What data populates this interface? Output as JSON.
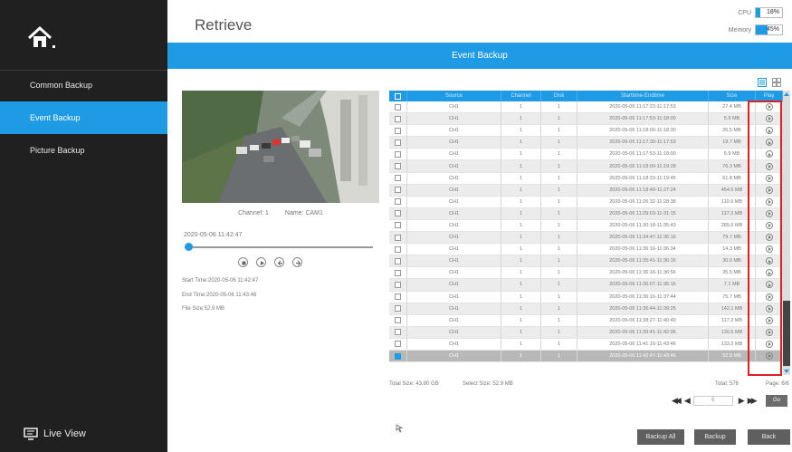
{
  "sidebar": {
    "items": [
      {
        "label": "Common Backup",
        "active": false
      },
      {
        "label": "Event Backup",
        "active": true
      },
      {
        "label": "Picture Backup",
        "active": false
      }
    ],
    "live_view": "Live View"
  },
  "header": {
    "title": "Retrieve",
    "cpu": {
      "label": "CPU",
      "value": "18%",
      "level": 0.18
    },
    "memory": {
      "label": "Memory",
      "value": "45%",
      "level": 0.45
    }
  },
  "banner": {
    "title": "Event Backup"
  },
  "preview": {
    "channel": "Channel: 1",
    "name": "Name: CAM1",
    "timestamp": "2020-05-06 11:42:47",
    "start_time": "Start Time:2020-05-06 11:42:47",
    "end_time": "End Time:2020-05-06 11:43:46",
    "file_size": "File Size:52.9 MB"
  },
  "table": {
    "columns": [
      "Source",
      "Channel",
      "Disk",
      "Starttime-Endtime",
      "Size",
      "Play"
    ],
    "rows": [
      {
        "source": "CH1",
        "channel": "1",
        "disk": "1",
        "time": "2020-05-06 11:17:23-11:17:53",
        "size": "27.4 MB",
        "checked": false
      },
      {
        "source": "CH1",
        "channel": "1",
        "disk": "1",
        "time": "2020-05-06 11:17:53-11:18:00",
        "size": "5.9 MB",
        "checked": false
      },
      {
        "source": "CH1",
        "channel": "1",
        "disk": "1",
        "time": "2020-05-06 11:18:00-11:18:30",
        "size": "26.5 MB",
        "checked": false
      },
      {
        "source": "CH1",
        "channel": "1",
        "disk": "1",
        "time": "2020-05-06 11:17:30-11:17:53",
        "size": "19.7 MB",
        "checked": false
      },
      {
        "source": "CH1",
        "channel": "1",
        "disk": "1",
        "time": "2020-05-06 11:17:53-11:18:00",
        "size": "5.9 MB",
        "checked": false
      },
      {
        "source": "CH1",
        "channel": "1",
        "disk": "1",
        "time": "2020-05-06 11:18:00-11:19:28",
        "size": "76.3 MB",
        "checked": false
      },
      {
        "source": "CH1",
        "channel": "1",
        "disk": "1",
        "time": "2020-05-06 11:18:33-11:19:45",
        "size": "61.8 MB",
        "checked": false
      },
      {
        "source": "CH1",
        "channel": "1",
        "disk": "1",
        "time": "2020-05-06 11:18:49-11:27:24",
        "size": "454.5 MB",
        "checked": false
      },
      {
        "source": "CH1",
        "channel": "1",
        "disk": "1",
        "time": "2020-05-06 11:26:32-11:28:38",
        "size": "110.9 MB",
        "checked": false
      },
      {
        "source": "CH1",
        "channel": "1",
        "disk": "1",
        "time": "2020-05-06 11:29:03-11:31:15",
        "size": "117.3 MB",
        "checked": false
      },
      {
        "source": "CH1",
        "channel": "1",
        "disk": "1",
        "time": "2020-05-06 11:30:18-11:35:43",
        "size": "285.6 MB",
        "checked": false
      },
      {
        "source": "CH1",
        "channel": "1",
        "disk": "1",
        "time": "2020-05-06 11:34:47-11:36:16",
        "size": "79.7 MB",
        "checked": false
      },
      {
        "source": "CH1",
        "channel": "1",
        "disk": "1",
        "time": "2020-05-06 11:36:16-11:36:34",
        "size": "14.3 MB",
        "checked": false
      },
      {
        "source": "CH1",
        "channel": "1",
        "disk": "1",
        "time": "2020-05-06 11:35:41-11:36:16",
        "size": "30.0 MB",
        "checked": false
      },
      {
        "source": "CH1",
        "channel": "1",
        "disk": "1",
        "time": "2020-05-06 11:36:16-11:36:56",
        "size": "35.5 MB",
        "checked": false
      },
      {
        "source": "CH1",
        "channel": "1",
        "disk": "1",
        "time": "2020-05-06 11:36:07-11:36:16",
        "size": "7.1 MB",
        "checked": false
      },
      {
        "source": "CH1",
        "channel": "1",
        "disk": "1",
        "time": "2020-05-06 11:36:16-11:37:44",
        "size": "75.7 MB",
        "checked": false
      },
      {
        "source": "CH1",
        "channel": "1",
        "disk": "1",
        "time": "2020-05-06 11:36:44-11:39:25",
        "size": "142.1 MB",
        "checked": false
      },
      {
        "source": "CH1",
        "channel": "1",
        "disk": "1",
        "time": "2020-05-06 11:38:27-11:40:40",
        "size": "117.3 MB",
        "checked": false
      },
      {
        "source": "CH1",
        "channel": "1",
        "disk": "1",
        "time": "2020-05-06 11:39:41-11:42:06",
        "size": "130.5 MB",
        "checked": false
      },
      {
        "source": "CH1",
        "channel": "1",
        "disk": "1",
        "time": "2020-05-06 11:41:16-11:43:46",
        "size": "133.2 MB",
        "checked": false
      },
      {
        "source": "CH1",
        "channel": "1",
        "disk": "1",
        "time": "2020-05-06 11:42:47-11:43:46",
        "size": "52.9 MB",
        "checked": true
      }
    ]
  },
  "summary": {
    "total_size": "Total Size: 43.80 GB",
    "select_size": "Select Size: 52.9 MB",
    "total": "Total: 576",
    "page": "Page: 6/6",
    "page_input": "6"
  },
  "buttons": {
    "go": "Go",
    "backup_all": "Backup All",
    "backup": "Backup",
    "back": "Back"
  },
  "colors": {
    "accent": "#1e9be4",
    "sidebar": "#202020",
    "highlight": "#e02020"
  }
}
